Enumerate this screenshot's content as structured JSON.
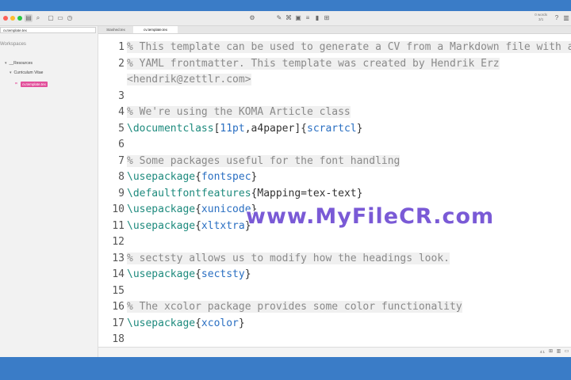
{
  "app": {
    "word_count": "0 words",
    "char_count": "3/1"
  },
  "sidebar": {
    "search_value": "cv.template.tex",
    "workspaces_label": "Workspaces",
    "tree": [
      {
        "label": "__Resources",
        "arrow": "▾"
      },
      {
        "label": "Curriculum Vitae",
        "arrow": "▾"
      }
    ],
    "selected_file": "cv.template.tex"
  },
  "tabs": [
    {
      "label": "Stashed.tex",
      "active": false
    },
    {
      "label": "cv.template.tex",
      "active": true
    }
  ],
  "editor": {
    "lines": [
      {
        "n": "1",
        "tokens": [
          {
            "t": "comment",
            "v": "% This template can be used to generate a CV from a Markdown file with a"
          }
        ]
      },
      {
        "n": "2",
        "tokens": [
          {
            "t": "comment",
            "v": "% YAML frontmatter. This template was created by Hendrik Erz "
          }
        ],
        "cont": [
          {
            "t": "comment",
            "v": "<hendrik@zettlr.com>"
          }
        ]
      },
      {
        "n": "3",
        "tokens": []
      },
      {
        "n": "4",
        "tokens": [
          {
            "t": "comment",
            "v": "% We're using the KOMA Article class"
          }
        ]
      },
      {
        "n": "5",
        "tokens": [
          {
            "t": "cmd",
            "v": "\\documentclass"
          },
          {
            "t": "plain",
            "v": "["
          },
          {
            "t": "arg",
            "v": "11pt"
          },
          {
            "t": "plain",
            "v": ",a4paper]{"
          },
          {
            "t": "arg",
            "v": "scrartcl"
          },
          {
            "t": "plain",
            "v": "}"
          }
        ]
      },
      {
        "n": "6",
        "tokens": []
      },
      {
        "n": "7",
        "tokens": [
          {
            "t": "comment",
            "v": "% Some packages useful for the font handling"
          }
        ]
      },
      {
        "n": "8",
        "tokens": [
          {
            "t": "cmd",
            "v": "\\usepackage"
          },
          {
            "t": "plain",
            "v": "{"
          },
          {
            "t": "arg",
            "v": "fontspec"
          },
          {
            "t": "plain",
            "v": "}"
          }
        ]
      },
      {
        "n": "9",
        "tokens": [
          {
            "t": "cmd",
            "v": "\\defaultfontfeatures"
          },
          {
            "t": "plain",
            "v": "{Mapping=tex-text}"
          }
        ]
      },
      {
        "n": "10",
        "tokens": [
          {
            "t": "cmd",
            "v": "\\usepackage"
          },
          {
            "t": "plain",
            "v": "{"
          },
          {
            "t": "arg",
            "v": "xunicode"
          },
          {
            "t": "plain",
            "v": "}"
          }
        ]
      },
      {
        "n": "11",
        "tokens": [
          {
            "t": "cmd",
            "v": "\\usepackage"
          },
          {
            "t": "plain",
            "v": "{"
          },
          {
            "t": "arg",
            "v": "xltxtra"
          },
          {
            "t": "plain",
            "v": "}"
          }
        ]
      },
      {
        "n": "12",
        "tokens": []
      },
      {
        "n": "13",
        "tokens": [
          {
            "t": "comment",
            "v": "% sectsty allows us to modify how the headings look."
          }
        ]
      },
      {
        "n": "14",
        "tokens": [
          {
            "t": "cmd",
            "v": "\\usepackage"
          },
          {
            "t": "plain",
            "v": "{"
          },
          {
            "t": "arg",
            "v": "sectsty"
          },
          {
            "t": "plain",
            "v": "}"
          }
        ]
      },
      {
        "n": "15",
        "tokens": []
      },
      {
        "n": "16",
        "tokens": [
          {
            "t": "comment",
            "v": "% The xcolor package provides some color functionality"
          }
        ]
      },
      {
        "n": "17",
        "tokens": [
          {
            "t": "cmd",
            "v": "\\usepackage"
          },
          {
            "t": "plain",
            "v": "{"
          },
          {
            "t": "arg",
            "v": "xcolor"
          },
          {
            "t": "plain",
            "v": "}"
          }
        ]
      },
      {
        "n": "18",
        "tokens": []
      }
    ]
  },
  "statusbar": {
    "position": "4:1"
  },
  "watermark": "www.MyFileCR.com",
  "colors": {
    "accent": "#e2509b",
    "comment": "#8a8a8a",
    "command": "#1d8a7d",
    "argument": "#2a6fc2",
    "background": "#3a7cc7"
  }
}
